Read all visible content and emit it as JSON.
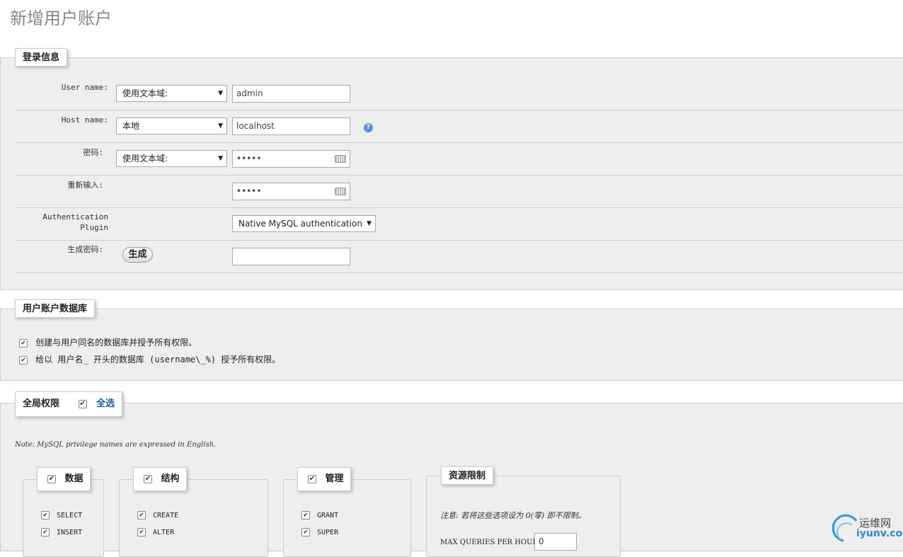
{
  "page_title": "新增用户账户",
  "login": {
    "legend": "登录信息",
    "username_label": "User name:",
    "username_type": "使用文本域:",
    "username_value": "admin",
    "hostname_label": "Host name:",
    "hostname_type": "本地",
    "hostname_value": "localhost",
    "password_label": "密码:",
    "password_type": "使用文本域:",
    "password_value": "•••••",
    "retype_label": "重新输入:",
    "retype_value": "•••••",
    "auth_label_line1": "Authentication",
    "auth_label_line2": "Plugin",
    "auth_plugin": "Native MySQL authentication",
    "generate_label": "生成密码:",
    "generate_button": "生成",
    "generated_value": ""
  },
  "database": {
    "legend": "用户账户数据库",
    "option1": "创建与用户同名的数据库并授予所有权限。",
    "option2": "给以 用户名_ 开头的数据库 (username\\_%) 授予所有权限。"
  },
  "global": {
    "legend": "全局权限",
    "select_all": "全选",
    "note": "Note: MySQL privilege names are expressed in English.",
    "groups": {
      "data": {
        "title": "数据",
        "items": [
          "SELECT",
          "INSERT"
        ]
      },
      "structure": {
        "title": "结构",
        "items": [
          "CREATE",
          "ALTER"
        ]
      },
      "admin": {
        "title": "管理",
        "items": [
          "GRANT",
          "SUPER"
        ]
      }
    },
    "resources": {
      "title": "资源限制",
      "note": "注意: 若将这些选项设为 0(零) 即不限制。",
      "max_queries_label": "MAX QUERIES PER HOUR",
      "max_queries_value": "0"
    }
  },
  "watermark": {
    "text": "运维网",
    "url_text": "iyunv.com"
  },
  "colors": {
    "panel": "#eeeeee",
    "border": "#cccccc",
    "select_all": "#1a5a9c"
  }
}
